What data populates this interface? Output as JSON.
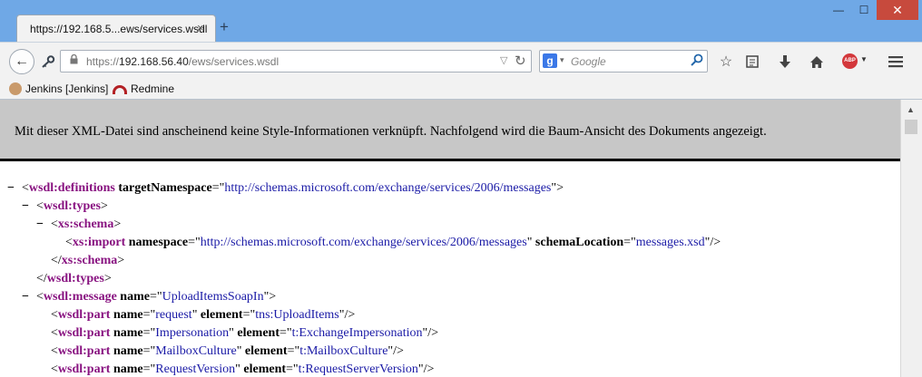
{
  "window": {
    "tab_title": "https://192.168.5...ews/services.wsdl",
    "tab_close": "×",
    "new_tab": "+",
    "minimize": "—",
    "maximize": "☐",
    "close": "✕"
  },
  "navbar": {
    "back": "←",
    "url_prefix": "https://",
    "url_host": "192.168.56.40",
    "url_path": "/ews/services.wsdl",
    "search_engine": "g",
    "search_placeholder": "Google",
    "icons": [
      "star-icon",
      "reader-icon",
      "download-icon",
      "home-icon",
      "adblock-icon",
      "menu-icon"
    ]
  },
  "bookmarks": [
    {
      "label": "Jenkins [Jenkins]"
    },
    {
      "label": "Redmine"
    }
  ],
  "content": {
    "info_message": "Mit dieser XML-Datei sind anscheinend keine Style-Informationen verknüpft. Nachfolgend wird die Baum-Ansicht des Dokuments angezeigt.",
    "xml_lines": [
      {
        "fold": "−",
        "open": "<",
        "tag": "wsdl:definitions",
        "attrs": [
          {
            "n": "targetNamespace",
            "v": "http://schemas.microsoft.com/exchange/services/2006/messages"
          }
        ],
        "close": ">"
      },
      {
        "fold": "−",
        "open": "<",
        "tag": "wsdl:types",
        "attrs": [],
        "close": ">"
      },
      {
        "fold": "−",
        "open": "<",
        "tag": "xs:schema",
        "attrs": [],
        "close": ">"
      },
      {
        "fold": "",
        "open": "<",
        "tag": "xs:import",
        "attrs": [
          {
            "n": "namespace",
            "v": "http://schemas.microsoft.com/exchange/services/2006/messages"
          },
          {
            "n": "schemaLocation",
            "v": "messages.xsd"
          }
        ],
        "close": "/>"
      },
      {
        "fold": "",
        "open": "</",
        "tag": "xs:schema",
        "attrs": [],
        "close": ">"
      },
      {
        "fold": "",
        "open": "</",
        "tag": "wsdl:types",
        "attrs": [],
        "close": ">"
      },
      {
        "fold": "−",
        "open": "<",
        "tag": "wsdl:message",
        "attrs": [
          {
            "n": "name",
            "v": "UploadItemsSoapIn"
          }
        ],
        "close": ">"
      },
      {
        "fold": "",
        "open": "<",
        "tag": "wsdl:part",
        "attrs": [
          {
            "n": "name",
            "v": "request"
          },
          {
            "n": "element",
            "v": "tns:UploadItems"
          }
        ],
        "close": "/>"
      },
      {
        "fold": "",
        "open": "<",
        "tag": "wsdl:part",
        "attrs": [
          {
            "n": "name",
            "v": "Impersonation"
          },
          {
            "n": "element",
            "v": "t:ExchangeImpersonation"
          }
        ],
        "close": "/>"
      },
      {
        "fold": "",
        "open": "<",
        "tag": "wsdl:part",
        "attrs": [
          {
            "n": "name",
            "v": "MailboxCulture"
          },
          {
            "n": "element",
            "v": "t:MailboxCulture"
          }
        ],
        "close": "/>"
      },
      {
        "fold": "",
        "open": "<",
        "tag": "wsdl:part",
        "attrs": [
          {
            "n": "name",
            "v": "RequestVersion"
          },
          {
            "n": "element",
            "v": "t:RequestServerVersion"
          }
        ],
        "close": "/>"
      }
    ]
  },
  "colors": {
    "tag": "#881280",
    "attr_value": "#1a1aa6",
    "info_bg": "#c7c7c7",
    "titlebar": "#6fa8e6"
  }
}
